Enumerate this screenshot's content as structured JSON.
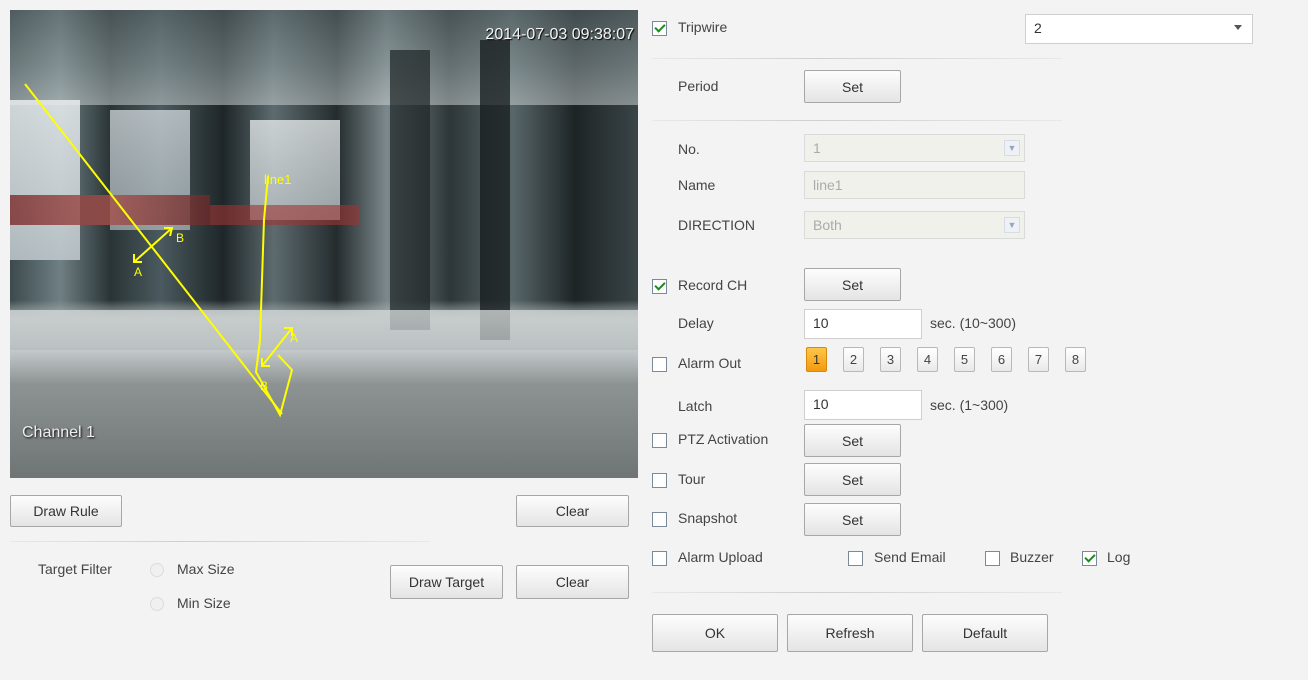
{
  "video": {
    "timestamp": "2014-07-03 09:38:07",
    "channel_label": "Channel 1",
    "overlay": {
      "line_label": "line1",
      "direction_labels": [
        "B",
        "A",
        "A",
        "B"
      ],
      "line_color": "#ffff00"
    }
  },
  "left_controls": {
    "draw_rule": "Draw Rule",
    "clear_rule": "Clear",
    "target_filter_label": "Target Filter",
    "max_size": "Max Size",
    "min_size": "Min Size",
    "draw_target": "Draw Target",
    "clear_target": "Clear"
  },
  "tripwire": {
    "label": "Tripwire",
    "checked": true,
    "rule_select": "2"
  },
  "period": {
    "label": "Period",
    "button": "Set"
  },
  "rule": {
    "no_label": "No.",
    "no_value": "1",
    "name_label": "Name",
    "name_value": "line1",
    "direction_label": "DIRECTION",
    "direction_value": "Both"
  },
  "record_ch": {
    "label": "Record CH",
    "checked": true,
    "button": "Set"
  },
  "delay": {
    "label": "Delay",
    "value": "10",
    "unit": "sec. (10~300)"
  },
  "alarm_out": {
    "label": "Alarm Out",
    "checked": false,
    "outputs": [
      "1",
      "2",
      "3",
      "4",
      "5",
      "6",
      "7",
      "8"
    ],
    "active": "1"
  },
  "latch": {
    "label": "Latch",
    "value": "10",
    "unit": "sec. (1~300)"
  },
  "ptz": {
    "label": "PTZ Activation",
    "checked": false,
    "button": "Set"
  },
  "tour": {
    "label": "Tour",
    "checked": false,
    "button": "Set"
  },
  "snapshot": {
    "label": "Snapshot",
    "checked": false,
    "button": "Set"
  },
  "alarm_upload": {
    "label": "Alarm Upload",
    "checked": false
  },
  "send_email": {
    "label": "Send Email",
    "checked": false
  },
  "buzzer": {
    "label": "Buzzer",
    "checked": false
  },
  "log": {
    "label": "Log",
    "checked": true
  },
  "footer": {
    "ok": "OK",
    "refresh": "Refresh",
    "default": "Default"
  }
}
